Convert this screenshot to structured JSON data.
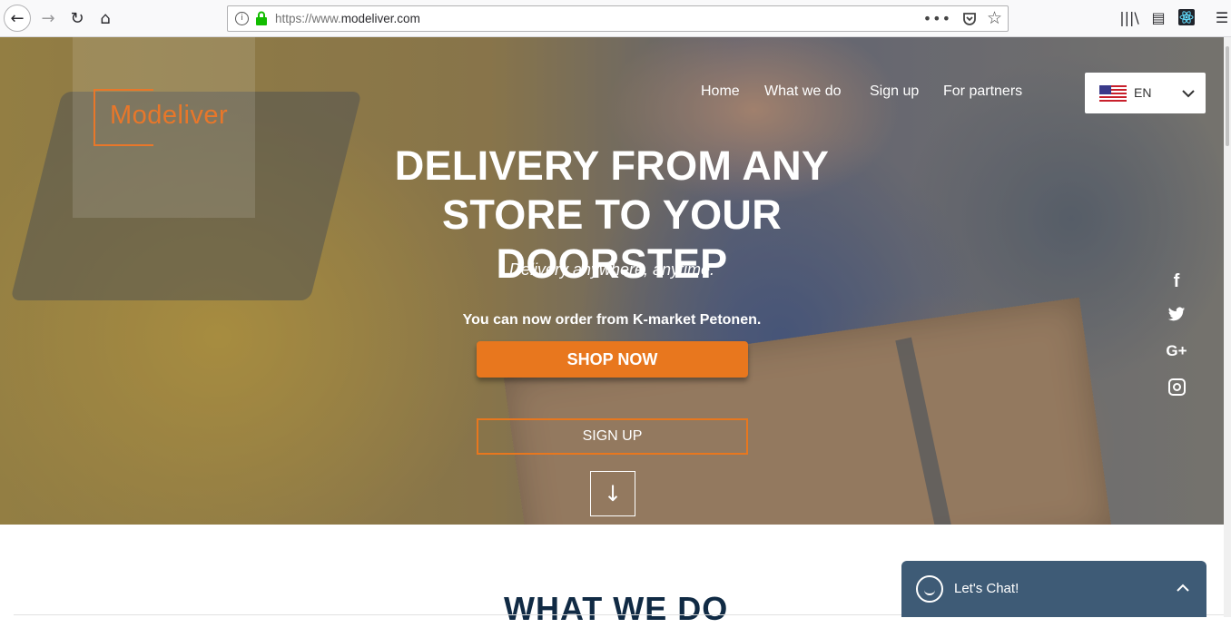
{
  "browser": {
    "url_prefix": "https://www.",
    "url_domain": "modeliver.com",
    "back_icon": "←",
    "forward_icon": "→",
    "reload_icon": "↻",
    "home_icon": "⌂",
    "more_icon": "•••",
    "star_icon": "☆",
    "library_icon": "|||\\",
    "sidebar_icon": "▤",
    "menu_icon": "☰"
  },
  "site": {
    "logo": "Modeliver",
    "nav": [
      "Home",
      "What we do",
      "Sign up",
      "For partners"
    ],
    "language": {
      "code": "EN"
    },
    "hero": {
      "headline_line1": "DELIVERY FROM ANY",
      "headline_line2": "STORE TO YOUR DOORSTEP",
      "tagline": "Delivery anywhere, anytime.",
      "order_note": "You can now order from K-market Petonen.",
      "shop_button": "SHOP NOW",
      "signup_button": "SIGN UP",
      "scroll_icon": "↓"
    },
    "social": {
      "facebook": "f",
      "google": "G+"
    },
    "section_title": "WHAT WE DO"
  },
  "chat": {
    "label": "Let's Chat!",
    "chevron": "⌃"
  },
  "colors": {
    "accent": "#e8772a",
    "chat_bg": "#3e5b76",
    "title_navy": "#102a44"
  }
}
